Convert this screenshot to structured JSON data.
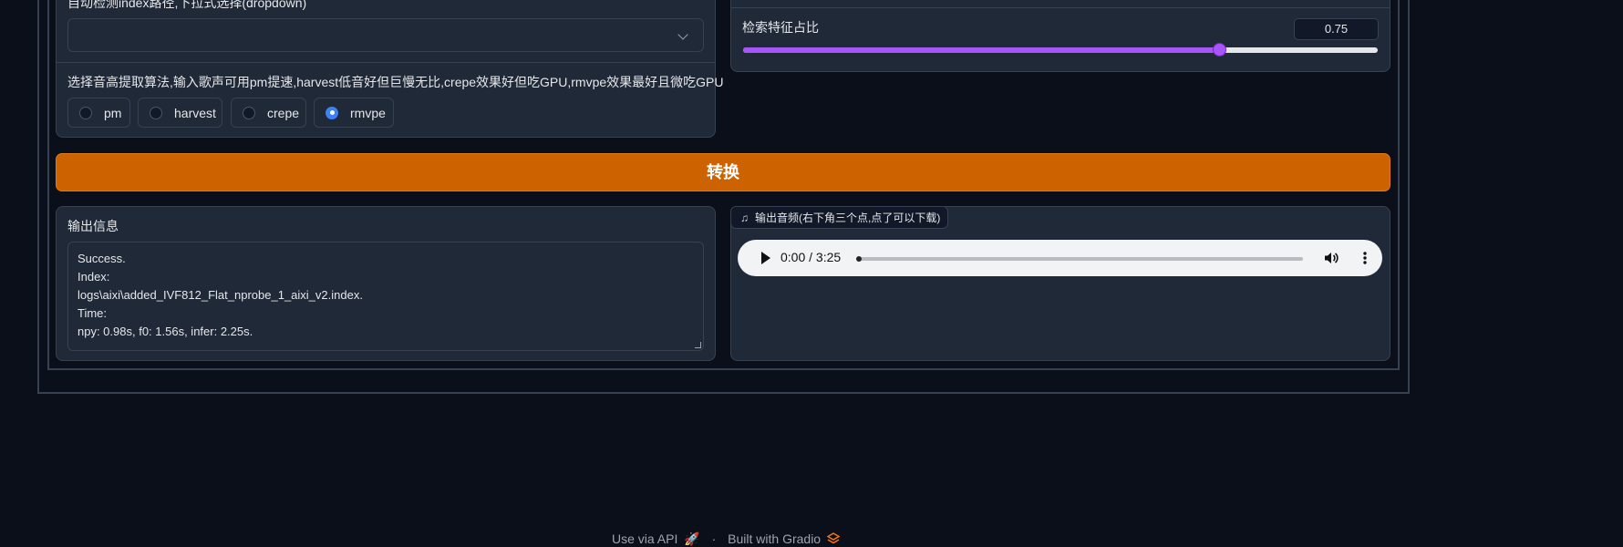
{
  "left_panel": {
    "index_dropdown_label": "自动检测index路径,下拉式选择(dropdown)",
    "index_dropdown_value": "",
    "pitch_algo_label": "选择音高提取算法,输入歌声可用pm提速,harvest低音好但巨慢无比,crepe效果好但吃GPU,rmvpe效果最好且微吃GPU",
    "pitch_options": [
      {
        "label": "pm",
        "checked": false
      },
      {
        "label": "harvest",
        "checked": false
      },
      {
        "label": "crepe",
        "checked": false
      },
      {
        "label": "rmvpe",
        "checked": true
      }
    ]
  },
  "right_panel": {
    "index_rate_label": "检索特征占比",
    "index_rate_value": "0.75",
    "slider_fraction": 0.75
  },
  "convert_button_label": "转换",
  "output_info": {
    "label": "输出信息",
    "lines": [
      "Success.",
      "Index:",
      "logs\\aixi\\added_IVF812_Flat_nprobe_1_aixi_v2.index.",
      "Time:",
      "npy: 0.98s, f0: 1.56s, infer: 2.25s."
    ]
  },
  "output_audio": {
    "label": "输出音频(右下角三个点,点了可以下载)",
    "time_display": "0:00 / 3:25",
    "progress_fraction": 0.0
  },
  "footer": {
    "api_link": "Use via API",
    "api_emoji": "🚀",
    "separator": "·",
    "built_with": "Built with Gradio",
    "gradio_logo": "gradio-logo-icon"
  },
  "colors": {
    "background": "#0b0f19",
    "panel": "#1f2937",
    "border": "#374151",
    "accent_orange": "#cc6300",
    "slider_purple": "#a855f7",
    "radio_blue": "#3b82f6"
  }
}
